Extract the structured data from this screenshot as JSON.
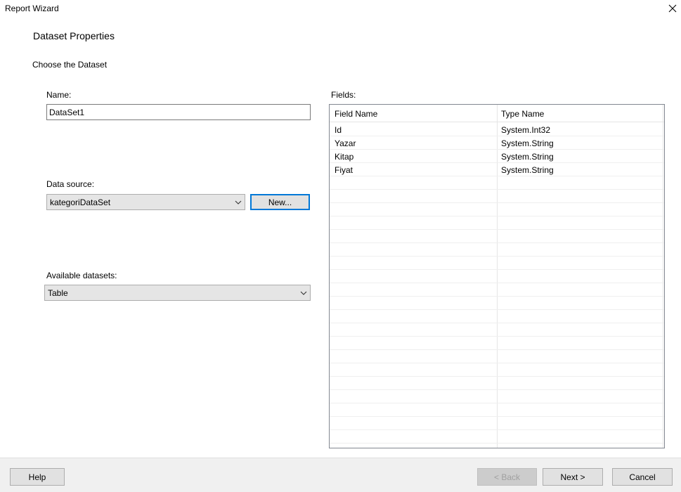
{
  "window": {
    "title": "Report Wizard"
  },
  "page": {
    "heading": "Dataset Properties",
    "subheading": "Choose the Dataset"
  },
  "name_field": {
    "label": "Name:",
    "value": "DataSet1"
  },
  "data_source": {
    "label": "Data source:",
    "selected": "kategoriDataSet",
    "new_button": "New..."
  },
  "available_datasets": {
    "label": "Available datasets:",
    "selected": "Table"
  },
  "fields": {
    "label": "Fields:",
    "columns": [
      "Field Name",
      "Type Name"
    ],
    "rows": [
      [
        "Id",
        "System.Int32"
      ],
      [
        "Yazar",
        "System.String"
      ],
      [
        "Kitap",
        "System.String"
      ],
      [
        "Fiyat",
        "System.String"
      ]
    ]
  },
  "footer": {
    "help": "Help",
    "back": "< Back",
    "next": "Next >",
    "cancel": "Cancel"
  },
  "colors": {
    "accent": "#0078d7",
    "footer_bg": "#f0f0f0",
    "combo_bg": "#e5e5e5"
  }
}
